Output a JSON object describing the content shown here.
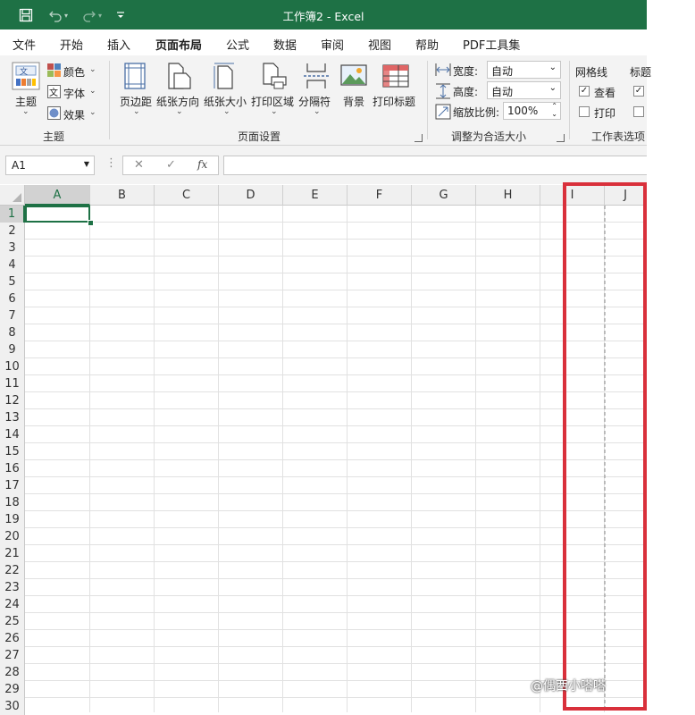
{
  "window": {
    "title": "工作簿2 - Excel"
  },
  "tabs": [
    "文件",
    "开始",
    "插入",
    "页面布局",
    "公式",
    "数据",
    "审阅",
    "视图",
    "帮助",
    "PDF工具集"
  ],
  "active_tab": "页面布局",
  "ribbon": {
    "theme_group": {
      "theme_label": "主题",
      "colors_label": "颜色",
      "fonts_label": "字体",
      "effects_label": "效果",
      "group_label": "主题"
    },
    "page_setup_group": {
      "margins_label": "页边距",
      "orientation_label": "纸张方向",
      "size_label": "纸张大小",
      "print_area_label": "打印区域",
      "breaks_label": "分隔符",
      "background_label": "背景",
      "print_titles_label": "打印标题",
      "group_label": "页面设置"
    },
    "scale_group": {
      "width_label": "宽度:",
      "width_value": "自动",
      "height_label": "高度:",
      "height_value": "自动",
      "scale_label": "缩放比例:",
      "scale_value": "100%",
      "group_label": "调整为合适大小"
    },
    "sheet_options_group": {
      "gridlines_label": "网格线",
      "headings_label": "标题",
      "view_label": "查看",
      "print_label": "打印",
      "gridlines_view_checked": true,
      "gridlines_print_checked": false,
      "group_label": "工作表选项"
    }
  },
  "formula_bar": {
    "name_box": "A1",
    "fx_label": "fx",
    "formula": ""
  },
  "sheet": {
    "columns": [
      "A",
      "B",
      "C",
      "D",
      "E",
      "F",
      "G",
      "H",
      "I",
      "J"
    ],
    "rows": [
      "1",
      "2",
      "3",
      "4",
      "5",
      "6",
      "7",
      "8",
      "9",
      "10",
      "11",
      "12",
      "13",
      "14",
      "15",
      "16",
      "17",
      "18",
      "19",
      "20",
      "21",
      "22",
      "23",
      "24",
      "25",
      "26",
      "27",
      "28",
      "29",
      "30"
    ],
    "selected_cell": "A1"
  },
  "colors": {
    "accent": "#1e7145",
    "highlight": "#d9303b"
  },
  "watermark": "@偶西小嗒嗒"
}
